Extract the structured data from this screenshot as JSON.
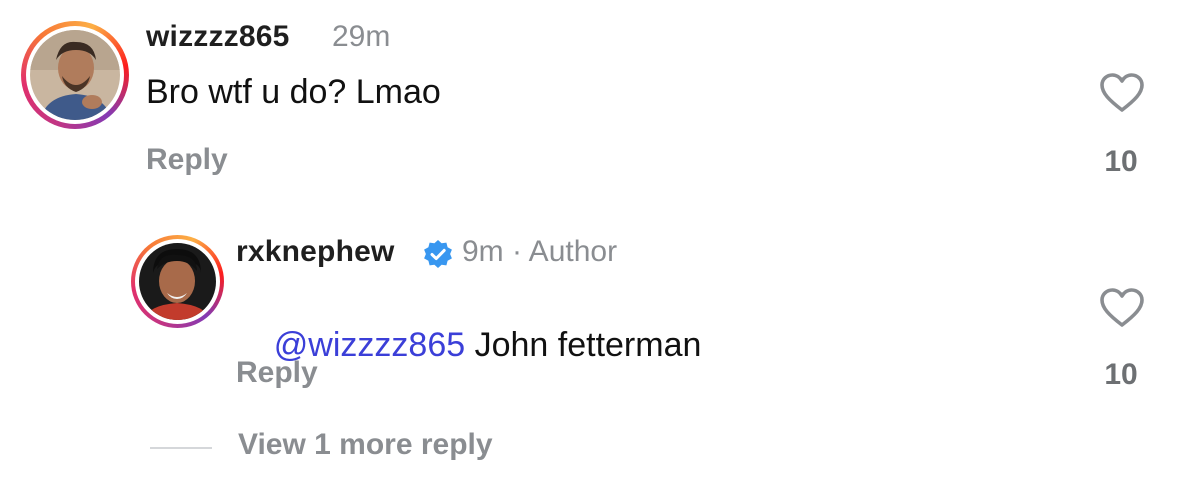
{
  "comments": [
    {
      "username": "wizzzz865",
      "time": "29m",
      "text": "Bro wtf u do? Lmao",
      "reply_label": "Reply",
      "likes": "10"
    }
  ],
  "replies": [
    {
      "username": "rxknephew",
      "verified": true,
      "meta": "9m · Author",
      "mention": "@wizzzz865",
      "text": " John fetterman",
      "reply_label": "Reply",
      "likes": "10"
    }
  ],
  "view_more": "View 1 more reply",
  "colors": {
    "mention": "#3b3fd8",
    "verified_badge": "#3897f0",
    "muted_text": "#8a8d91"
  }
}
